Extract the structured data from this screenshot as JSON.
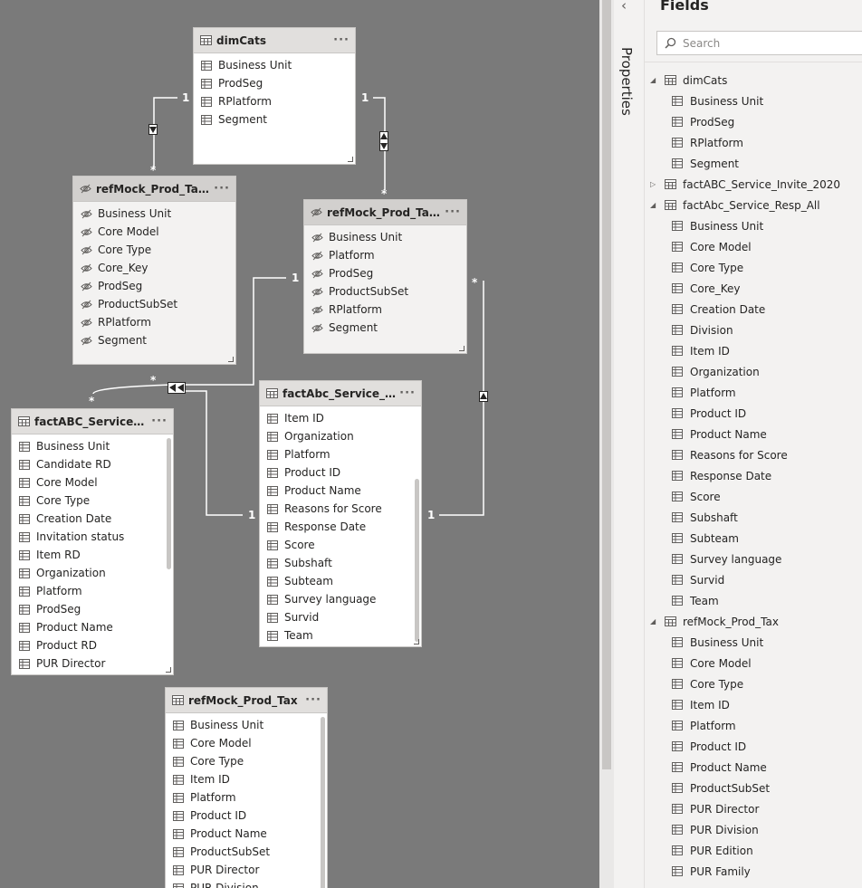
{
  "model": {
    "tables": [
      {
        "id": "dimCats",
        "title": "dimCats",
        "hidden": false,
        "fields": [
          "Business Unit",
          "ProdSeg",
          "RPlatform",
          "Segment"
        ]
      },
      {
        "id": "taxcore",
        "title": "refMock_Prod_TaxCore",
        "hidden": true,
        "fields": [
          "Business Unit",
          "Core Model",
          "Core Type",
          "Core_Key",
          "ProdSeg",
          "ProductSubSet",
          "RPlatform",
          "Segment"
        ]
      },
      {
        "id": "taxpl",
        "title": "refMock_Prod_TaxPl...",
        "hidden": true,
        "fields": [
          "Business Unit",
          "Platform",
          "ProdSeg",
          "ProductSubSet",
          "RPlatform",
          "Segment"
        ]
      },
      {
        "id": "invite",
        "title": "factABC_Service_Invi...",
        "hidden": false,
        "fields": [
          "Business Unit",
          "Candidate RD",
          "Core Model",
          "Core Type",
          "Creation Date",
          "Invitation status",
          "Item RD",
          "Organization",
          "Platform",
          "ProdSeg",
          "Product Name",
          "Product RD",
          "PUR Director"
        ]
      },
      {
        "id": "resp",
        "title": "factAbc_Service_Res...",
        "hidden": false,
        "fields": [
          "Item ID",
          "Organization",
          "Platform",
          "Product ID",
          "Product Name",
          "Reasons for Score",
          "Response Date",
          "Score",
          "Subshaft",
          "Subteam",
          "Survey language",
          "Survid",
          "Team"
        ]
      },
      {
        "id": "tax",
        "title": "refMock_Prod_Tax",
        "hidden": false,
        "fields": [
          "Business Unit",
          "Core Model",
          "Core Type",
          "Item ID",
          "Platform",
          "Product ID",
          "Product Name",
          "ProductSubSet",
          "PUR Director",
          "PUR Division"
        ]
      }
    ],
    "more_label": "···",
    "cardinality": {
      "one": "1",
      "many": "*"
    }
  },
  "properties_pane": {
    "title": "Properties",
    "back_icon": "chevron-left-icon"
  },
  "fields_pane": {
    "title": "Fields",
    "search_placeholder": "Search",
    "tree": [
      {
        "name": "dimCats",
        "expanded": true,
        "fields": [
          "Business Unit",
          "ProdSeg",
          "RPlatform",
          "Segment"
        ]
      },
      {
        "name": "factABC_Service_Invite_2020",
        "expanded": false,
        "fields": []
      },
      {
        "name": "factAbc_Service_Resp_All",
        "expanded": true,
        "fields": [
          "Business Unit",
          "Core Model",
          "Core Type",
          "Core_Key",
          "Creation Date",
          "Division",
          "Item ID",
          "Organization",
          "Platform",
          "Product ID",
          "Product Name",
          "Reasons for Score",
          "Response Date",
          "Score",
          "Subshaft",
          "Subteam",
          "Survey language",
          "Survid",
          "Team"
        ]
      },
      {
        "name": "refMock_Prod_Tax",
        "expanded": true,
        "fields": [
          "Business Unit",
          "Core Model",
          "Core Type",
          "Item ID",
          "Platform",
          "Product ID",
          "Product Name",
          "ProductSubSet",
          "PUR Director",
          "PUR Division",
          "PUR Edition",
          "PUR Family"
        ]
      }
    ]
  },
  "colors": {
    "canvas": "#7a7a7a",
    "pane": "#f3f2f1",
    "header": "#e1dfdd",
    "line": "#ffffff"
  }
}
